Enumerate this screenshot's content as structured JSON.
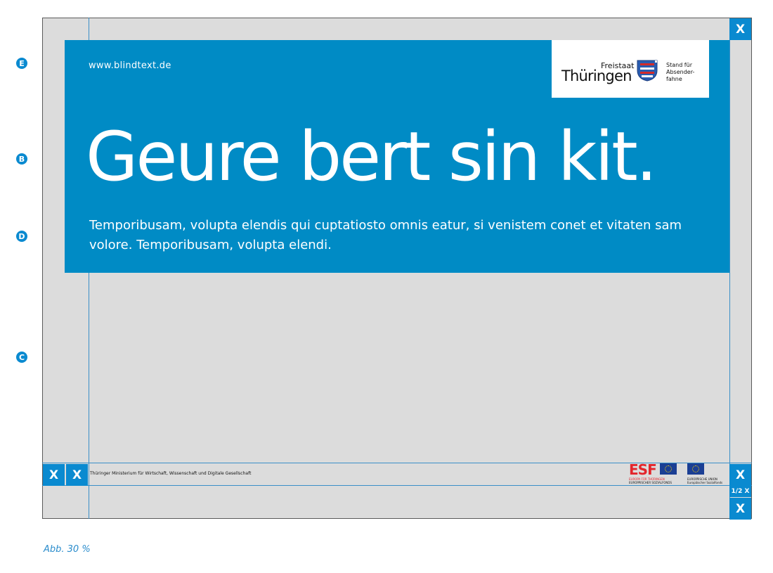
{
  "markers": [
    "E",
    "B",
    "D",
    "C"
  ],
  "panel": {
    "url": "www.blindtext.de",
    "headline": "Geure bert sin kit.",
    "body": "Temporibusam, volupta elendis qui cuptatiosto omnis eatur, si venistem conet et vitaten sam volore. Temporibusam, volupta elendi."
  },
  "logo": {
    "freistaat": "Freistaat",
    "name": "Thüringen",
    "slogan_line1": "Stand für",
    "slogan_line2": "Absender-",
    "slogan_line3": "fahne"
  },
  "footer": {
    "ministry": "Thüringer Ministerium für Wirtschaft, Wissenschaft und Digitale Gesellschaft",
    "esf_logo": "ESF",
    "esf_sub1": "EUROPA FÜR THÜRINGEN",
    "esf_sub2": "EUROPÄISCHER SOZIALFONDS",
    "eu_sub1": "EUROPÄISCHE UNION",
    "eu_sub2": "Europäischer Sozialfonds"
  },
  "spacing_labels": {
    "x": "X",
    "half_x": "1/2 X"
  },
  "caption": "Abb. 30 %",
  "colors": {
    "panel_blue": "#008bc5",
    "marker_blue": "#0a8ad0",
    "canvas_gray": "#dcdcdc",
    "esf_red": "#e3262c",
    "eu_blue": "#1b3f94"
  }
}
